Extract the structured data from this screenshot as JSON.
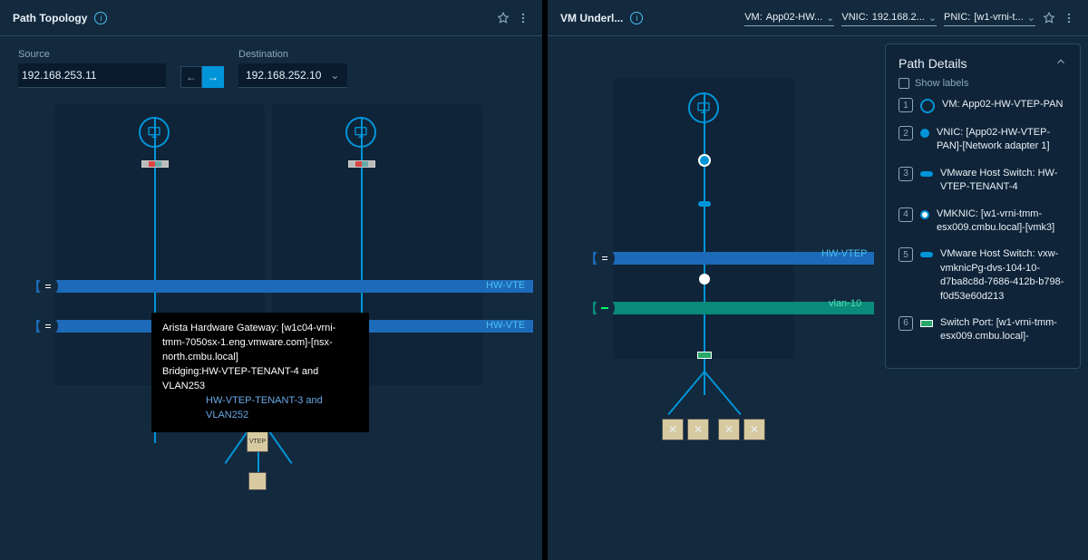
{
  "left": {
    "title": "Path Topology",
    "source_label": "Source",
    "source_value": "192.168.253.11",
    "dest_label": "Destination",
    "dest_value": "192.168.252.10",
    "hbar_label": "HW-VTE",
    "tooltip": {
      "l1": "Arista Hardware Gateway: [w1c04-vrni-tmm-7050sx-1.eng.vmware.com]-[nsx-north.cmbu.local]",
      "l2": "Bridging:HW-VTEP-TENANT-4 and VLAN253",
      "l3": "HW-VTEP-TENANT-3 and VLAN252"
    },
    "router_label": "VTEP"
  },
  "right": {
    "title": "VM Underl...",
    "select1_prefix": "VM:",
    "select1_value": "App02-HW...",
    "select2_prefix": "VNIC:",
    "select2_value": "192.168.2...",
    "select3_prefix": "PNIC:",
    "select3_value": "[w1-vrni-t...",
    "hbar_label_blue": "HW-VTEP",
    "hbar_label_teal": "vlan-10"
  },
  "details": {
    "title": "Path Details",
    "show_labels": "Show labels",
    "items": [
      {
        "n": "1",
        "icon": "ring",
        "text": "VM: App02-HW-VTEP-PAN"
      },
      {
        "n": "2",
        "icon": "dot",
        "text": "VNIC: [App02-HW-VTEP-PAN]-[Network adapter 1]"
      },
      {
        "n": "3",
        "icon": "pill",
        "text": "VMware Host Switch: HW-VTEP-TENANT-4"
      },
      {
        "n": "4",
        "icon": "dot-outline",
        "text": "VMKNIC: [w1-vrni-tmm-esx009.cmbu.local]-[vmk3]"
      },
      {
        "n": "5",
        "icon": "pill",
        "text": "VMware Host Switch: vxw-vmknicPg-dvs-104-10-d7ba8c8d-7686-412b-b798-f0d53e60d213"
      },
      {
        "n": "6",
        "icon": "port",
        "text": "Switch Port: [w1-vrni-tmm-esx009.cmbu.local]-"
      }
    ]
  }
}
